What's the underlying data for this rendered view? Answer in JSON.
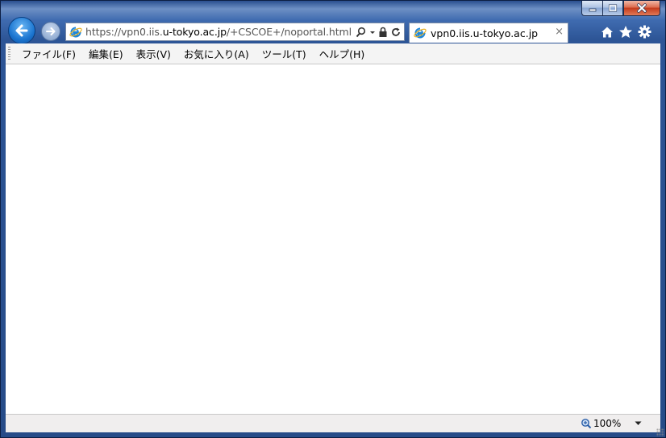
{
  "window": {
    "caption_buttons": {
      "minimize": "minimize-icon",
      "maximize": "maximize-icon",
      "close": "close-icon"
    }
  },
  "nav": {
    "back_icon": "arrow-left-icon",
    "forward_icon": "arrow-right-icon"
  },
  "address_bar": {
    "url_prefix": "https://vpn0.iis.",
    "url_domain": "u-tokyo.ac.jp",
    "url_path": "/+CSCOE+/noportal.html",
    "tools": [
      "search-icon",
      "dropdown-icon",
      "lock-icon",
      "refresh-icon"
    ]
  },
  "tab": {
    "title": "vpn0.iis.u-tokyo.ac.jp",
    "close": "×"
  },
  "toolbar_right": [
    "home-icon",
    "star-icon",
    "gear-icon"
  ],
  "menu": {
    "items": [
      "ファイル(F)",
      "編集(E)",
      "表示(V)",
      "お気に入り(A)",
      "ツール(T)",
      "ヘルプ(H)"
    ]
  },
  "status": {
    "zoom": "100%"
  },
  "colors": {
    "frame": "#2d5596",
    "accent": "#1b75d0",
    "menubar": "#f4f4f4"
  }
}
